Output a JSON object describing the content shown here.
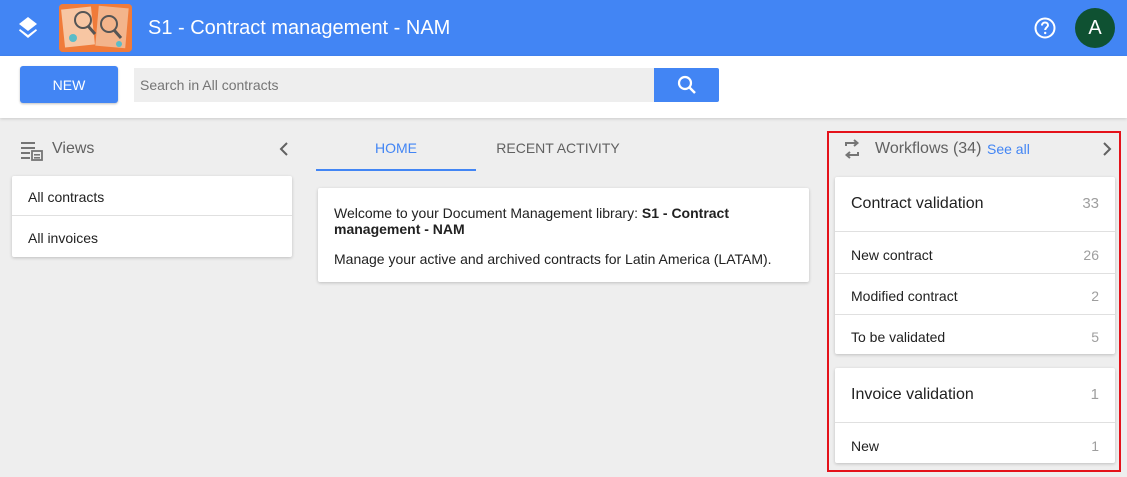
{
  "header": {
    "title": "S1 - Contract management - NAM",
    "avatar_initial": "A",
    "accent_color": "#4285f4"
  },
  "toolbar": {
    "new_label": "NEW",
    "search_placeholder": "Search in All contracts"
  },
  "views": {
    "title": "Views",
    "items": [
      {
        "label": "All contracts"
      },
      {
        "label": "All invoices"
      }
    ]
  },
  "tabs": [
    {
      "label": "HOME",
      "active": true
    },
    {
      "label": "RECENT ACTIVITY",
      "active": false
    }
  ],
  "welcome": {
    "intro": "Welcome to your Document Management library: ",
    "library_name": "S1 - Contract management - NAM",
    "description": "Manage your active and archived contracts for Latin America (LATAM)."
  },
  "workflows": {
    "title": "Workflows (34)",
    "see_all": "See all",
    "groups": [
      {
        "title": "Contract validation",
        "count": "33",
        "items": [
          {
            "label": "New contract",
            "count": "26"
          },
          {
            "label": "Modified contract",
            "count": "2"
          },
          {
            "label": "To be validated",
            "count": "5"
          }
        ]
      },
      {
        "title": "Invoice validation",
        "count": "1",
        "items": [
          {
            "label": "New",
            "count": "1"
          }
        ]
      }
    ]
  }
}
